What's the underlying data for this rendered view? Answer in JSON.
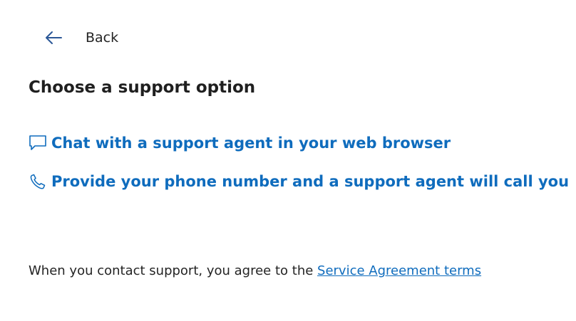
{
  "header": {
    "back_label": "Back",
    "back_icon": "arrow-left-icon"
  },
  "main": {
    "title": "Choose a support option",
    "options": [
      {
        "label": "Chat with a support agent in your web browser",
        "icon": "chat-bubble-icon"
      },
      {
        "label": "Provide your phone number and a support agent will call you",
        "icon": "phone-icon"
      }
    ]
  },
  "footer": {
    "text": "When you contact support, you agree to the ",
    "link_label": "Service Agreement terms"
  },
  "colors": {
    "link": "#0f6cbd",
    "text": "#242424",
    "background": "#ffffff"
  }
}
